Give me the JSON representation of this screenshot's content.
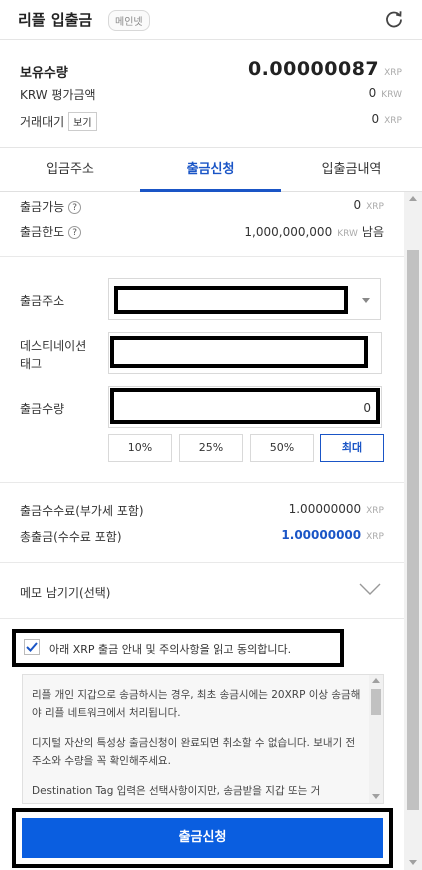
{
  "header": {
    "title": "리플 입출금",
    "network_badge": "메인넷",
    "refresh_icon": "refresh-icon"
  },
  "summary": {
    "holding_label": "보유수량",
    "holding_value": "0.00000087",
    "holding_unit": "XRP",
    "krw_label": "KRW 평가금액",
    "krw_value": "0",
    "krw_unit": "KRW",
    "pending_label": "거래대기",
    "pending_view_button": "보기",
    "pending_value": "0",
    "pending_unit": "XRP"
  },
  "tabs": [
    {
      "label": "입금주소"
    },
    {
      "label": "출금신청",
      "active": true
    },
    {
      "label": "입출금내역"
    }
  ],
  "limits": {
    "available_label": "출금가능",
    "available_value": "0",
    "available_unit": "XRP",
    "limit_label": "출금한도",
    "limit_value": "1,000,000,000",
    "limit_unit": "KRW",
    "limit_suffix": "남음",
    "help_glyph": "?"
  },
  "form": {
    "address_label": "출금주소",
    "tag_label_line1": "데스티네이션",
    "tag_label_line2": "태그",
    "amount_label": "출금수량",
    "amount_value": "0",
    "percent_buttons": [
      "10%",
      "25%",
      "50%",
      "최대"
    ]
  },
  "fees": {
    "fee_label": "출금수수료(부가세 포함)",
    "fee_value": "1.00000000",
    "fee_unit": "XRP",
    "total_label": "총출금(수수료 포함)",
    "total_value": "1.00000000",
    "total_unit": "XRP"
  },
  "memo": {
    "label": "메모 남기기(선택)"
  },
  "agreement": {
    "checked": true,
    "text": "아래 XRP 출금 안내 및 주의사항을 읽고 동의합니다."
  },
  "notice": {
    "paragraphs": [
      "리플 개인 지갑으로 송금하시는 경우, 최초 송금시에는 20XRP 이상 송금해야 리플 네트워크에서 처리됩니다.",
      "디지털 자산의 특성상 출금신청이 완료되면 취소할 수 없습니다. 보내기 전 주소와 수량을 꼭 확인해주세요.",
      "Destination Tag 입력은 선택사항이지만, 송금받을 지갑 또는 거"
    ]
  },
  "submit": {
    "label": "출금신청"
  },
  "colors": {
    "accent": "#1a55c6",
    "button": "#0a5ee0"
  }
}
